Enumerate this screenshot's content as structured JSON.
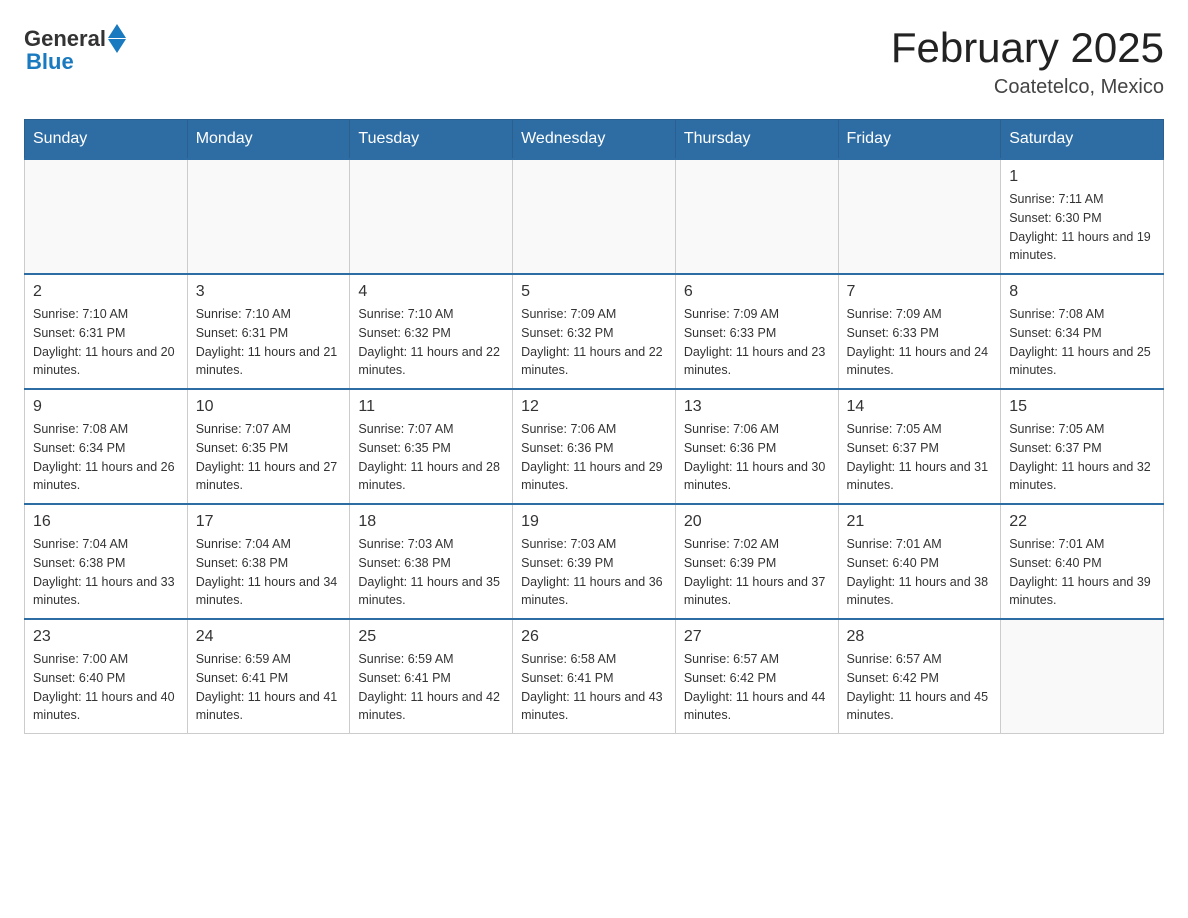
{
  "header": {
    "logo_general": "General",
    "logo_blue": "Blue",
    "month_title": "February 2025",
    "location": "Coatetelco, Mexico"
  },
  "weekdays": [
    "Sunday",
    "Monday",
    "Tuesday",
    "Wednesday",
    "Thursday",
    "Friday",
    "Saturday"
  ],
  "weeks": [
    [
      {
        "day": "",
        "sunrise": "",
        "sunset": "",
        "daylight": ""
      },
      {
        "day": "",
        "sunrise": "",
        "sunset": "",
        "daylight": ""
      },
      {
        "day": "",
        "sunrise": "",
        "sunset": "",
        "daylight": ""
      },
      {
        "day": "",
        "sunrise": "",
        "sunset": "",
        "daylight": ""
      },
      {
        "day": "",
        "sunrise": "",
        "sunset": "",
        "daylight": ""
      },
      {
        "day": "",
        "sunrise": "",
        "sunset": "",
        "daylight": ""
      },
      {
        "day": "1",
        "sunrise": "Sunrise: 7:11 AM",
        "sunset": "Sunset: 6:30 PM",
        "daylight": "Daylight: 11 hours and 19 minutes."
      }
    ],
    [
      {
        "day": "2",
        "sunrise": "Sunrise: 7:10 AM",
        "sunset": "Sunset: 6:31 PM",
        "daylight": "Daylight: 11 hours and 20 minutes."
      },
      {
        "day": "3",
        "sunrise": "Sunrise: 7:10 AM",
        "sunset": "Sunset: 6:31 PM",
        "daylight": "Daylight: 11 hours and 21 minutes."
      },
      {
        "day": "4",
        "sunrise": "Sunrise: 7:10 AM",
        "sunset": "Sunset: 6:32 PM",
        "daylight": "Daylight: 11 hours and 22 minutes."
      },
      {
        "day": "5",
        "sunrise": "Sunrise: 7:09 AM",
        "sunset": "Sunset: 6:32 PM",
        "daylight": "Daylight: 11 hours and 22 minutes."
      },
      {
        "day": "6",
        "sunrise": "Sunrise: 7:09 AM",
        "sunset": "Sunset: 6:33 PM",
        "daylight": "Daylight: 11 hours and 23 minutes."
      },
      {
        "day": "7",
        "sunrise": "Sunrise: 7:09 AM",
        "sunset": "Sunset: 6:33 PM",
        "daylight": "Daylight: 11 hours and 24 minutes."
      },
      {
        "day": "8",
        "sunrise": "Sunrise: 7:08 AM",
        "sunset": "Sunset: 6:34 PM",
        "daylight": "Daylight: 11 hours and 25 minutes."
      }
    ],
    [
      {
        "day": "9",
        "sunrise": "Sunrise: 7:08 AM",
        "sunset": "Sunset: 6:34 PM",
        "daylight": "Daylight: 11 hours and 26 minutes."
      },
      {
        "day": "10",
        "sunrise": "Sunrise: 7:07 AM",
        "sunset": "Sunset: 6:35 PM",
        "daylight": "Daylight: 11 hours and 27 minutes."
      },
      {
        "day": "11",
        "sunrise": "Sunrise: 7:07 AM",
        "sunset": "Sunset: 6:35 PM",
        "daylight": "Daylight: 11 hours and 28 minutes."
      },
      {
        "day": "12",
        "sunrise": "Sunrise: 7:06 AM",
        "sunset": "Sunset: 6:36 PM",
        "daylight": "Daylight: 11 hours and 29 minutes."
      },
      {
        "day": "13",
        "sunrise": "Sunrise: 7:06 AM",
        "sunset": "Sunset: 6:36 PM",
        "daylight": "Daylight: 11 hours and 30 minutes."
      },
      {
        "day": "14",
        "sunrise": "Sunrise: 7:05 AM",
        "sunset": "Sunset: 6:37 PM",
        "daylight": "Daylight: 11 hours and 31 minutes."
      },
      {
        "day": "15",
        "sunrise": "Sunrise: 7:05 AM",
        "sunset": "Sunset: 6:37 PM",
        "daylight": "Daylight: 11 hours and 32 minutes."
      }
    ],
    [
      {
        "day": "16",
        "sunrise": "Sunrise: 7:04 AM",
        "sunset": "Sunset: 6:38 PM",
        "daylight": "Daylight: 11 hours and 33 minutes."
      },
      {
        "day": "17",
        "sunrise": "Sunrise: 7:04 AM",
        "sunset": "Sunset: 6:38 PM",
        "daylight": "Daylight: 11 hours and 34 minutes."
      },
      {
        "day": "18",
        "sunrise": "Sunrise: 7:03 AM",
        "sunset": "Sunset: 6:38 PM",
        "daylight": "Daylight: 11 hours and 35 minutes."
      },
      {
        "day": "19",
        "sunrise": "Sunrise: 7:03 AM",
        "sunset": "Sunset: 6:39 PM",
        "daylight": "Daylight: 11 hours and 36 minutes."
      },
      {
        "day": "20",
        "sunrise": "Sunrise: 7:02 AM",
        "sunset": "Sunset: 6:39 PM",
        "daylight": "Daylight: 11 hours and 37 minutes."
      },
      {
        "day": "21",
        "sunrise": "Sunrise: 7:01 AM",
        "sunset": "Sunset: 6:40 PM",
        "daylight": "Daylight: 11 hours and 38 minutes."
      },
      {
        "day": "22",
        "sunrise": "Sunrise: 7:01 AM",
        "sunset": "Sunset: 6:40 PM",
        "daylight": "Daylight: 11 hours and 39 minutes."
      }
    ],
    [
      {
        "day": "23",
        "sunrise": "Sunrise: 7:00 AM",
        "sunset": "Sunset: 6:40 PM",
        "daylight": "Daylight: 11 hours and 40 minutes."
      },
      {
        "day": "24",
        "sunrise": "Sunrise: 6:59 AM",
        "sunset": "Sunset: 6:41 PM",
        "daylight": "Daylight: 11 hours and 41 minutes."
      },
      {
        "day": "25",
        "sunrise": "Sunrise: 6:59 AM",
        "sunset": "Sunset: 6:41 PM",
        "daylight": "Daylight: 11 hours and 42 minutes."
      },
      {
        "day": "26",
        "sunrise": "Sunrise: 6:58 AM",
        "sunset": "Sunset: 6:41 PM",
        "daylight": "Daylight: 11 hours and 43 minutes."
      },
      {
        "day": "27",
        "sunrise": "Sunrise: 6:57 AM",
        "sunset": "Sunset: 6:42 PM",
        "daylight": "Daylight: 11 hours and 44 minutes."
      },
      {
        "day": "28",
        "sunrise": "Sunrise: 6:57 AM",
        "sunset": "Sunset: 6:42 PM",
        "daylight": "Daylight: 11 hours and 45 minutes."
      },
      {
        "day": "",
        "sunrise": "",
        "sunset": "",
        "daylight": ""
      }
    ]
  ]
}
